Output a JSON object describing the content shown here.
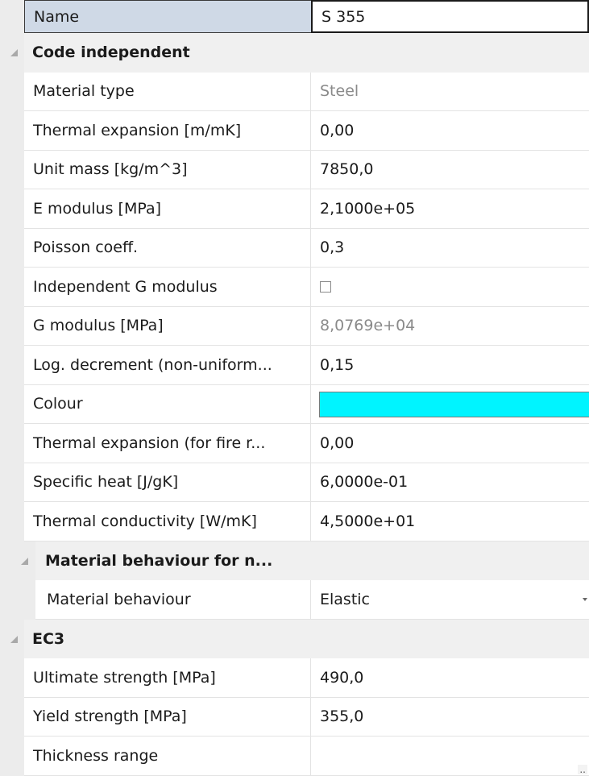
{
  "name_row": {
    "label": "Name",
    "value": "S 355"
  },
  "code_independent": {
    "title": "Code independent",
    "rows": [
      {
        "label": "Material type",
        "value": "Steel"
      },
      {
        "label": "Thermal expansion  [m/mK]",
        "value": "0,00"
      },
      {
        "label": "Unit mass [kg/m^3]",
        "value": "7850,0"
      },
      {
        "label": "E modulus [MPa]",
        "value": "2,1000e+05"
      },
      {
        "label": "Poisson coeff.",
        "value": "0,3"
      },
      {
        "label": "Independent G modulus",
        "checked": false
      },
      {
        "label": "G modulus [MPa]",
        "value": "8,0769e+04"
      },
      {
        "label": "Log. decrement (non-uniform...",
        "value": "0,15"
      },
      {
        "label": "Colour",
        "color": "#00f4ff"
      },
      {
        "label": "Thermal expansion (for fire r...",
        "value": "0,00"
      },
      {
        "label": "Specific heat [J/gK]",
        "value": "6,0000e-01"
      },
      {
        "label": "Thermal conductivity [W/mK]",
        "value": "4,5000e+01"
      }
    ]
  },
  "material_behaviour": {
    "title": "Material behaviour for n...",
    "rows": [
      {
        "label": "Material behaviour",
        "value": "Elastic"
      }
    ]
  },
  "ec3": {
    "title": "EC3",
    "rows": [
      {
        "label": "Ultimate strength [MPa]",
        "value": "490,0"
      },
      {
        "label": "Yield strength [MPa]",
        "value": "355,0"
      },
      {
        "label": "Thickness range",
        "value": ""
      }
    ]
  },
  "colors": {
    "section_bg": "#f0f0f0",
    "selected_bg": "#cfd9e6",
    "swatch": "#00f4ff"
  }
}
